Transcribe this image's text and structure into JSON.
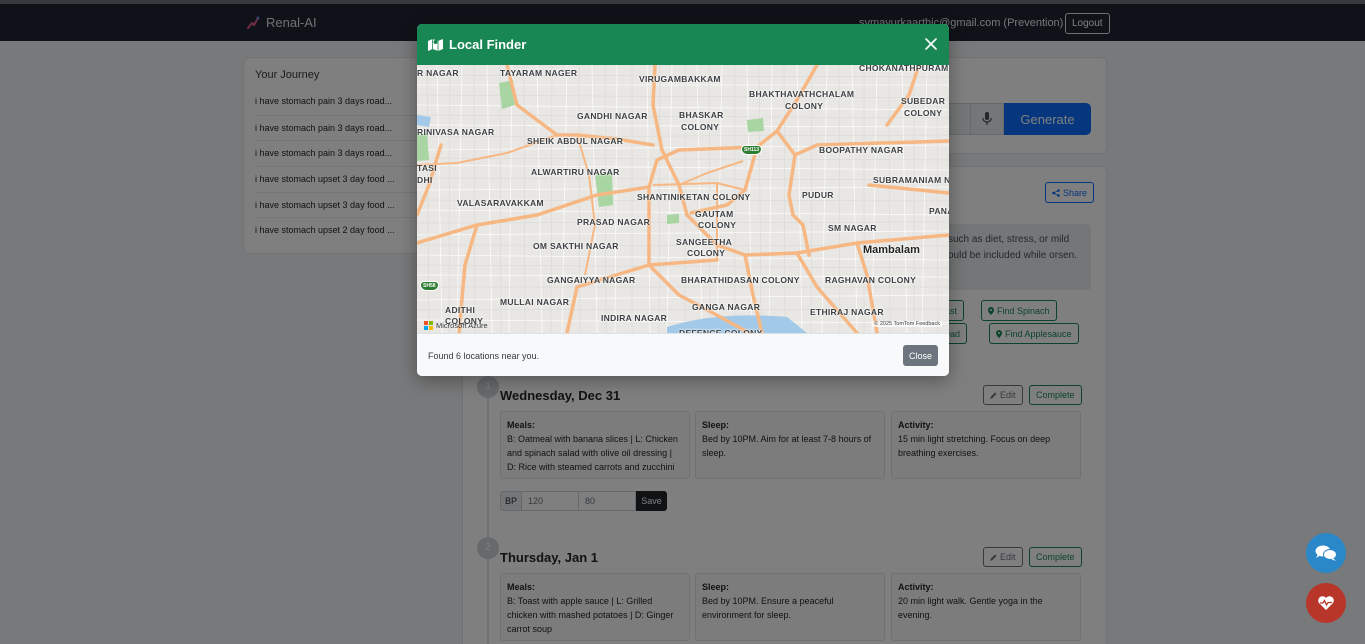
{
  "nav": {
    "brand": "Renal-AI",
    "user_email": "symayurkaarthic@gmail.com (Prevention)",
    "logout_label": "Logout"
  },
  "sidebar": {
    "title": "Your Journey",
    "items": [
      "i have stomach pain 3 days road...",
      "i have stomach pain 3 days road...",
      "i have stomach pain 3 days road...",
      "i have stomach upset 3 day food ...",
      "i have stomach upset 3 day food ...",
      "i have stomach upset 2 day food ..."
    ]
  },
  "main": {
    "generate_label": "Generate",
    "share_label": "Share",
    "info_text": "such as diet, stress, or mild ould be included while orsen.",
    "find_buttons": [
      {
        "label": "reast"
      },
      {
        "label": "Find Spinach"
      },
      {
        "label": "bread"
      },
      {
        "label": "Find Applesauce"
      }
    ]
  },
  "days": [
    {
      "step": "1",
      "title": "Wednesday, Dec 31",
      "edit_label": "Edit",
      "complete_label": "Complete",
      "meals_label": "Meals:",
      "meals": "B: Oatmeal with banana slices | L: Chicken and spinach salad with olive oil dressing | D: Rice with steamed carrots and zucchini",
      "sleep_label": "Sleep:",
      "sleep": "Bed by 10PM. Aim for at least 7-8 hours of sleep.",
      "activity_label": "Activity:",
      "activity": "15 min light stretching. Focus on deep breathing exercises.",
      "bp_label": "BP",
      "bp_systolic": "120",
      "bp_diastolic": "80",
      "save_label": "Save"
    },
    {
      "step": "2",
      "title": "Thursday, Jan 1",
      "edit_label": "Edit",
      "complete_label": "Complete",
      "meals_label": "Meals:",
      "meals": "B: Toast with apple sauce | L: Grilled chicken with mashed potatoes | D: Ginger carrot soup",
      "sleep_label": "Sleep:",
      "sleep": "Bed by 10PM. Ensure a peaceful environment for sleep.",
      "activity_label": "Activity:",
      "activity": "20 min light walk. Gentle yoga in the evening."
    }
  ],
  "modal": {
    "title": "Local Finder",
    "found_text": "Found 6 locations near you.",
    "close_label": "Close",
    "map": {
      "labels": [
        "CHOKANATHPURAM",
        "TAYARAM NAGER",
        "VIRUGAMBAKKAM",
        "BHAKTHAVATHCHALAM",
        "COLONY",
        "SUBEDAR",
        "COLONY",
        "R NAGAR",
        "GANDHI NAGAR",
        "BHASKAR",
        "COLONY",
        "RINIVASA NAGAR",
        "SHEIK ABDUL NAGAR",
        "BOOPATHY NAGAR",
        "ALWARTIRU NAGAR",
        "SUBRAMANIAM NA",
        "TASI",
        "DHI",
        "VALASARAVAKKAM",
        "SHANTINIKETAN COLONY",
        "PUDUR",
        "PANA",
        "GAUTAM",
        "COLONY",
        "PRASAD NAGAR",
        "SM NAGAR",
        "SANGEETHA",
        "COLONY",
        "Mambalam",
        "OM SAKTHI NAGAR",
        "GANGAIYYA NAGAR",
        "BHARATHIDASAN COLONY",
        "RAGHAVAN COLONY",
        "MULLAI NAGAR",
        "GANGA NAGAR",
        "ADITHI",
        "COLONY",
        "ETHIRAJ NAGAR",
        "INDIRA NAGAR",
        "DEFENCE COLONY"
      ],
      "shields": [
        "SH113",
        "SH58"
      ],
      "provider": "Microsoft Azure",
      "attribution": "© 2025 TomTom Feedback"
    }
  },
  "colors": {
    "navbar": "#1e2732",
    "modal_header": "#198754",
    "primary": "#0d6efd",
    "success": "#198754",
    "road_major": "#f6b783",
    "chat_fab": "#2a88c9",
    "health_fab": "#b8352a"
  },
  "icons": {
    "brand": "brand-logo-icon",
    "mic": "microphone-icon",
    "share": "share-icon",
    "pin": "map-pin-icon",
    "edit": "pencil-icon",
    "map": "map-icon",
    "close": "close-icon",
    "chat": "chat-bubbles-icon",
    "health": "heart-pulse-icon"
  }
}
